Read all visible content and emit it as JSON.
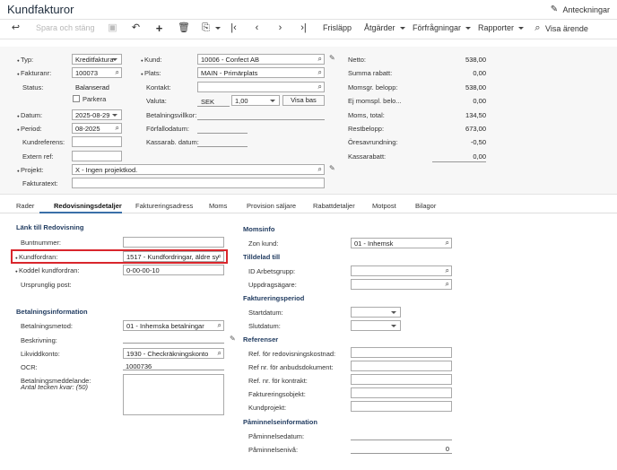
{
  "title": "Kundfakturor",
  "notes_label": "Anteckningar",
  "toolbar": {
    "save_close": "Spara och stäng",
    "release": "Frisläpp",
    "actions": "Åtgärder",
    "inquiries": "Förfrågningar",
    "reports": "Rapporter",
    "show_case": "Visa ärende"
  },
  "header": {
    "typ_label": "Typ:",
    "typ_value": "Kreditfaktura",
    "fakturanr_label": "Fakturanr:",
    "fakturanr_value": "100073",
    "status_label": "Status:",
    "status_value": "Balanserad",
    "parkera_label": "Parkera",
    "datum_label": "Datum:",
    "datum_value": "2025-08-29",
    "period_label": "Period:",
    "period_value": "08-2025",
    "kundref_label": "Kundreferens:",
    "kundref_value": "",
    "externref_label": "Extern ref:",
    "externref_value": "",
    "projekt_label": "Projekt:",
    "projekt_value": "X - Ingen projektkod.",
    "fakturatext_label": "Fakturatext:",
    "fakturatext_value": "",
    "kund_label": "Kund:",
    "kund_value": "10006 - Confect AB",
    "plats_label": "Plats:",
    "plats_value": "MAIN - Primärplats",
    "kontakt_label": "Kontakt:",
    "kontakt_value": "",
    "valuta_label": "Valuta:",
    "valuta_value": "SEK",
    "rate_value": "1,00",
    "visa_bas": "Visa bas",
    "betvillkor_label": "Betalningsvillkor:",
    "betvillkor_value": "",
    "forfall_label": "Förfallodatum:",
    "forfall_value": "",
    "kassarab_label": "Kassarab. datum:",
    "kassarab_value": "",
    "totals": [
      {
        "label": "Netto:",
        "value": "538,00"
      },
      {
        "label": "Summa rabatt:",
        "value": "0,00"
      },
      {
        "label": "Momsgr. belopp:",
        "value": "538,00"
      },
      {
        "label": "Ej momspl. belo...",
        "value": "0,00"
      },
      {
        "label": "Moms, total:",
        "value": "134,50"
      },
      {
        "label": "Restbelopp:",
        "value": "673,00"
      },
      {
        "label": "Öresavrundning:",
        "value": "-0,50"
      },
      {
        "label": "Kassarabatt:",
        "value": "0,00"
      }
    ]
  },
  "tabs": [
    "Rader",
    "Redovisningsdetaljer",
    "Faktureringsadress",
    "Moms",
    "Provision säljare",
    "Rabattdetaljer",
    "Motpost",
    "Bilagor"
  ],
  "left": {
    "sec1": "Länk till Redovisning",
    "buntnummer_label": "Buntnummer:",
    "buntnummer_value": "",
    "kundfordran_label": "Kundfordran:",
    "kundfordran_value": "1517 - Kundfordringar, äldre sy",
    "koddel_label": "Koddel kundfordran:",
    "koddel_value": "0-00-00-10",
    "urspr_label": "Ursprunglig post:",
    "urspr_value": "",
    "sec2": "Betalningsinformation",
    "betmetod_label": "Betalningsmetod:",
    "betmetod_value": "01 - Inhemska betalningar",
    "beskr_label": "Beskrivning:",
    "beskr_value": "",
    "likvid_label": "Likviddkonto:",
    "likvid_value": "1930 - Checkräkningskonto",
    "ocr_label": "OCR:",
    "ocr_value": "1000736",
    "betmedd_label": "Betalningsmeddelande:",
    "antal_label": "Antal tecken kvar: (50)"
  },
  "right": {
    "sec1": "Momsinfo",
    "zon_label": "Zon kund:",
    "zon_value": "01 - Inhemsk",
    "sec2": "Tilldelad till",
    "idarb_label": "ID Arbetsgrupp:",
    "idarb_value": "",
    "uppdrag_label": "Uppdragsägare:",
    "uppdrag_value": "",
    "sec3": "Faktureringsperiod",
    "start_label": "Startdatum:",
    "start_value": "",
    "slut_label": "Slutdatum:",
    "slut_value": "",
    "sec4": "Referenser",
    "ref1_label": "Ref. för redovisningskostnad:",
    "ref2_label": "Ref nr. för anbudsdokument:",
    "ref3_label": "Ref. nr. för kontrakt:",
    "ref4_label": "Faktureringsobjekt:",
    "ref5_label": "Kundprojekt:",
    "sec5": "Påminnelseinformation",
    "pamdatum_label": "Påminnelsedatum:",
    "pamdatum_value": "",
    "pamniva_label": "Påminnelsenivå:",
    "pamniva_value": "0"
  }
}
